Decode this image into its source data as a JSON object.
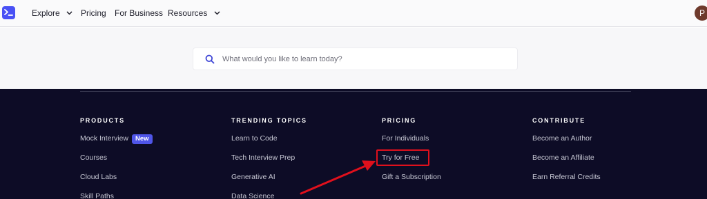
{
  "nav": {
    "logo_icon": "terminal-prompt-icon",
    "items": [
      {
        "label": "Explore",
        "has_dropdown": true
      },
      {
        "label": "Pricing",
        "has_dropdown": false
      },
      {
        "label": "For Business",
        "has_dropdown": false
      },
      {
        "label": "Resources",
        "has_dropdown": true
      }
    ],
    "avatar_initial": "P"
  },
  "search": {
    "placeholder": "What would you like to learn today?",
    "value": ""
  },
  "footer": {
    "columns": [
      {
        "heading": "PRODUCTS",
        "links": [
          "Mock Interview",
          "Courses",
          "Cloud Labs",
          "Skill Paths"
        ],
        "badge": "New"
      },
      {
        "heading": "TRENDING TOPICS",
        "links": [
          "Learn to Code",
          "Tech Interview Prep",
          "Generative AI",
          "Data Science"
        ]
      },
      {
        "heading": "PRICING",
        "links": [
          "For Individuals",
          "Try for Free",
          "Gift a Subscription"
        ]
      },
      {
        "heading": "CONTRIBUTE",
        "links": [
          "Become an Author",
          "Become an Affiliate",
          "Earn Referral Credits"
        ]
      }
    ]
  },
  "colors": {
    "brand": "#4951f5",
    "footer_bg": "#0d0c26",
    "annotation": "#e0101c",
    "badge": "#4f55e8"
  }
}
